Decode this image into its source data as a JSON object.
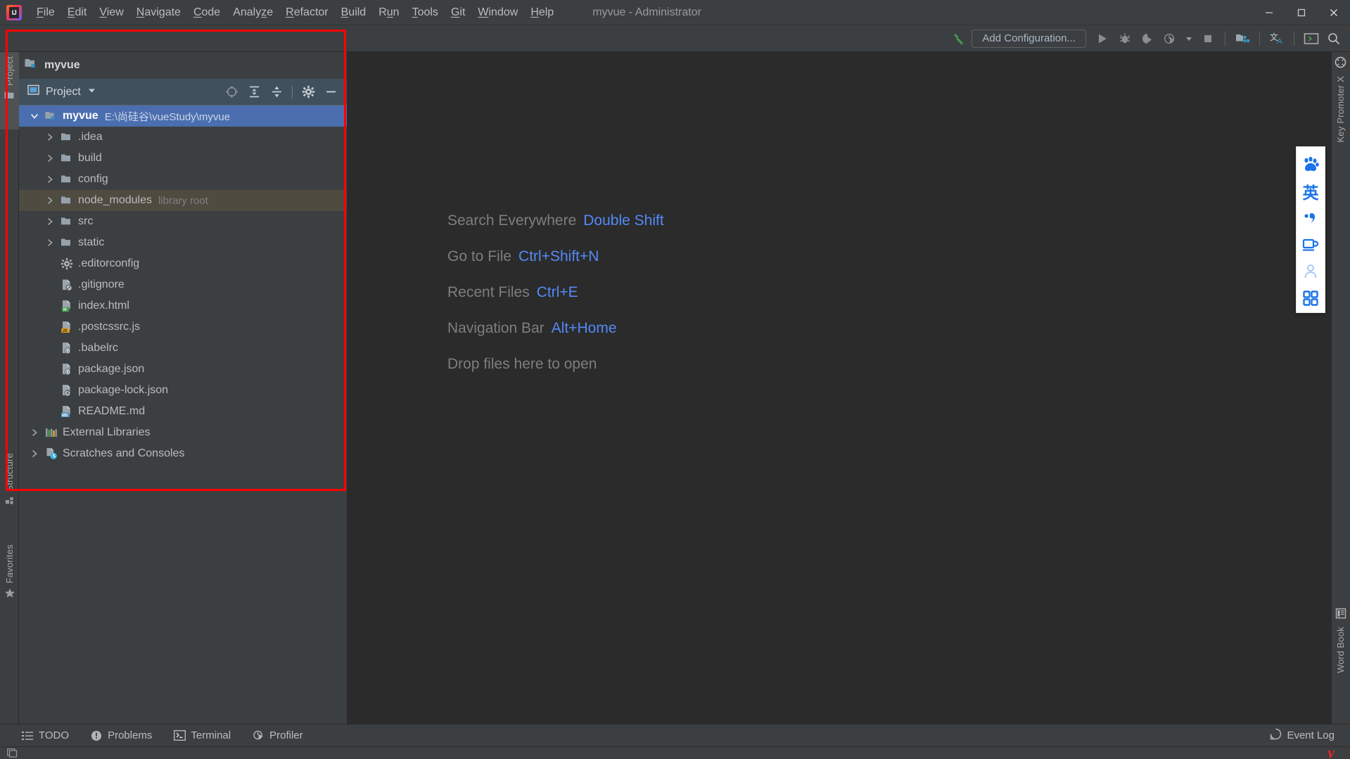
{
  "window": {
    "title": "myvue - Administrator",
    "app_logo": "intellij-idea-logo",
    "controls": {
      "minimize": "minimize-icon",
      "maximize": "maximize-icon",
      "close": "close-icon"
    }
  },
  "menubar": {
    "items": [
      {
        "label": "File",
        "mnemonic": "F"
      },
      {
        "label": "Edit",
        "mnemonic": "E"
      },
      {
        "label": "View",
        "mnemonic": "V"
      },
      {
        "label": "Navigate",
        "mnemonic": "N"
      },
      {
        "label": "Code",
        "mnemonic": "C"
      },
      {
        "label": "Analyze",
        "mnemonic": "z"
      },
      {
        "label": "Refactor",
        "mnemonic": "R"
      },
      {
        "label": "Build",
        "mnemonic": "B"
      },
      {
        "label": "Run",
        "mnemonic": "u"
      },
      {
        "label": "Tools",
        "mnemonic": "T"
      },
      {
        "label": "Git",
        "mnemonic": "G"
      },
      {
        "label": "Window",
        "mnemonic": "W"
      },
      {
        "label": "Help",
        "mnemonic": "H"
      }
    ]
  },
  "toolbar": {
    "build_icon": "hammer-icon",
    "add_configuration_label": "Add Configuration...",
    "run_icon": "run-icon",
    "debug_icon": "debug-icon",
    "run_with_coverage_icon": "coverage-icon",
    "profile_icon": "profiler-icon",
    "dropdown_icon": "chevron-down-icon",
    "stop_icon": "stop-icon",
    "project_structure_icon": "project-structure-icon",
    "translation_icon": "translation-icon",
    "terminal_icon": "terminal-icon",
    "search_icon": "search-icon"
  },
  "left_stripe": {
    "project_label": "Project",
    "project_icon": "folder-icon",
    "structure_label": "Structure",
    "structure_icon": "structure-icon",
    "favorites_label": "Favorites",
    "favorites_icon": "star-icon"
  },
  "right_stripe": {
    "key_promoter_label": "Key Promoter X",
    "key_promoter_icon": "key-promoter-icon",
    "word_book_label": "Word Book",
    "word_book_icon": "book-icon"
  },
  "project_panel": {
    "header_title": "myvue",
    "header_icon": "module-folder-icon",
    "view_selector_label": "Project",
    "view_selector_icon": "project-view-icon",
    "view_selector_chevron": "chevron-down-icon",
    "actions": {
      "scroll_from_source_icon": "crosshair-icon",
      "expand_all_icon": "expand-all-icon",
      "collapse_all_icon": "collapse-all-icon",
      "settings_icon": "gear-icon",
      "hide_icon": "minimize-icon"
    },
    "tree": [
      {
        "label": "myvue",
        "sub": "E:\\尚硅谷\\vueStudy\\myvue",
        "icon": "module-folder-icon",
        "indent": 0,
        "arrow": "expanded",
        "state": "selected",
        "bold": true
      },
      {
        "label": ".idea",
        "sub": "",
        "icon": "folder-icon",
        "indent": 1,
        "arrow": "collapsed",
        "state": "normal",
        "bold": false
      },
      {
        "label": "build",
        "sub": "",
        "icon": "folder-icon",
        "indent": 1,
        "arrow": "collapsed",
        "state": "normal",
        "bold": false
      },
      {
        "label": "config",
        "sub": "",
        "icon": "folder-icon",
        "indent": 1,
        "arrow": "collapsed",
        "state": "normal",
        "bold": false
      },
      {
        "label": "node_modules",
        "sub": "library root",
        "icon": "folder-icon",
        "indent": 1,
        "arrow": "collapsed",
        "state": "highlighted",
        "bold": false
      },
      {
        "label": "src",
        "sub": "",
        "icon": "folder-icon",
        "indent": 1,
        "arrow": "collapsed",
        "state": "normal",
        "bold": false
      },
      {
        "label": "static",
        "sub": "",
        "icon": "folder-icon",
        "indent": 1,
        "arrow": "collapsed",
        "state": "normal",
        "bold": false
      },
      {
        "label": ".editorconfig",
        "sub": "",
        "icon": "gear-file-icon",
        "indent": 1,
        "arrow": "none",
        "state": "normal",
        "bold": false
      },
      {
        "label": ".gitignore",
        "sub": "",
        "icon": "ignore-file-icon",
        "indent": 1,
        "arrow": "none",
        "state": "normal",
        "bold": false
      },
      {
        "label": "index.html",
        "sub": "",
        "icon": "html-file-icon",
        "indent": 1,
        "arrow": "none",
        "state": "normal",
        "bold": false
      },
      {
        "label": ".postcssrc.js",
        "sub": "",
        "icon": "js-file-icon",
        "indent": 1,
        "arrow": "none",
        "state": "normal",
        "bold": false
      },
      {
        "label": ".babelrc",
        "sub": "",
        "icon": "json-file-icon",
        "indent": 1,
        "arrow": "none",
        "state": "normal",
        "bold": false
      },
      {
        "label": "package.json",
        "sub": "",
        "icon": "json-file-icon",
        "indent": 1,
        "arrow": "none",
        "state": "normal",
        "bold": false
      },
      {
        "label": "package-lock.json",
        "sub": "",
        "icon": "json-lock-file-icon",
        "indent": 1,
        "arrow": "none",
        "state": "normal",
        "bold": false
      },
      {
        "label": "README.md",
        "sub": "",
        "icon": "markdown-file-icon",
        "indent": 1,
        "arrow": "none",
        "state": "normal",
        "bold": false
      },
      {
        "label": "External Libraries",
        "sub": "",
        "icon": "libraries-icon",
        "indent": 0,
        "arrow": "collapsed",
        "state": "normal",
        "bold": false
      },
      {
        "label": "Scratches and Consoles",
        "sub": "",
        "icon": "scratches-icon",
        "indent": 0,
        "arrow": "collapsed",
        "state": "normal",
        "bold": false
      }
    ]
  },
  "editor": {
    "hints": [
      {
        "action": "Search Everywhere",
        "shortcut": "Double Shift"
      },
      {
        "action": "Go to File",
        "shortcut": "Ctrl+Shift+N"
      },
      {
        "action": "Recent Files",
        "shortcut": "Ctrl+E"
      },
      {
        "action": "Navigation Bar",
        "shortcut": "Alt+Home"
      },
      {
        "action": "Drop files here to open",
        "shortcut": ""
      }
    ]
  },
  "ime_bar": {
    "buttons": [
      {
        "name": "paw-icon",
        "glyph": "🐾"
      },
      {
        "name": "language-mode-icon",
        "glyph": "英"
      },
      {
        "name": "punctuation-mode-icon",
        "glyph": "，"
      },
      {
        "name": "cup-icon",
        "glyph": "☕"
      },
      {
        "name": "user-icon",
        "glyph": "👤"
      },
      {
        "name": "grid-menu-icon",
        "glyph": "▦"
      }
    ]
  },
  "statusbar": {
    "items": [
      {
        "label": "TODO",
        "icon": "todo-icon"
      },
      {
        "label": "Problems",
        "icon": "problems-icon"
      },
      {
        "label": "Terminal",
        "icon": "terminal-icon"
      },
      {
        "label": "Profiler",
        "icon": "profiler-icon"
      }
    ],
    "event_log_label": "Event Log",
    "event_log_icon": "event-log-icon"
  },
  "taskbar": {
    "logo": "y"
  },
  "colors": {
    "accent_blue": "#548af7",
    "selection_blue": "#4b6eaf",
    "panel_header_blue": "#41505d",
    "background": "#3c3f41",
    "editor_background": "#2b2b2b",
    "annotation_red": "#ff0000"
  }
}
